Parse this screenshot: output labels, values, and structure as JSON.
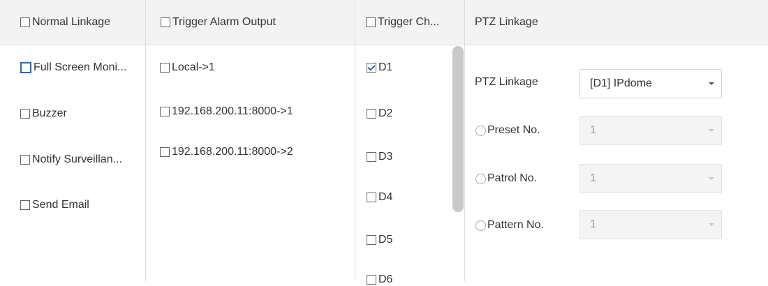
{
  "headers": {
    "normal_linkage": "Normal Linkage",
    "trigger_alarm_output": "Trigger Alarm Output",
    "trigger_channel": "Trigger Ch...",
    "ptz_linkage": "PTZ Linkage"
  },
  "normal_linkage_items": {
    "full_screen": "Full Screen Moni...",
    "buzzer": "Buzzer",
    "notify": "Notify Surveillan...",
    "send_email": "Send Email"
  },
  "alarm_outputs": {
    "local": "Local->1",
    "ip1": "192.168.200.11:8000->1",
    "ip2": "192.168.200.11:8000->2"
  },
  "channels": {
    "d1": "D1",
    "d2": "D2",
    "d3": "D3",
    "d4": "D4",
    "d5": "D5",
    "d6": "D6"
  },
  "ptz": {
    "linkage_label": "PTZ Linkage",
    "linkage_value": "[D1] IPdome",
    "preset_label": "Preset No.",
    "preset_value": "1",
    "patrol_label": "Patrol No.",
    "patrol_value": "1",
    "pattern_label": "Pattern No.",
    "pattern_value": "1"
  },
  "state": {
    "d1_checked": true,
    "full_screen_focused": true
  }
}
